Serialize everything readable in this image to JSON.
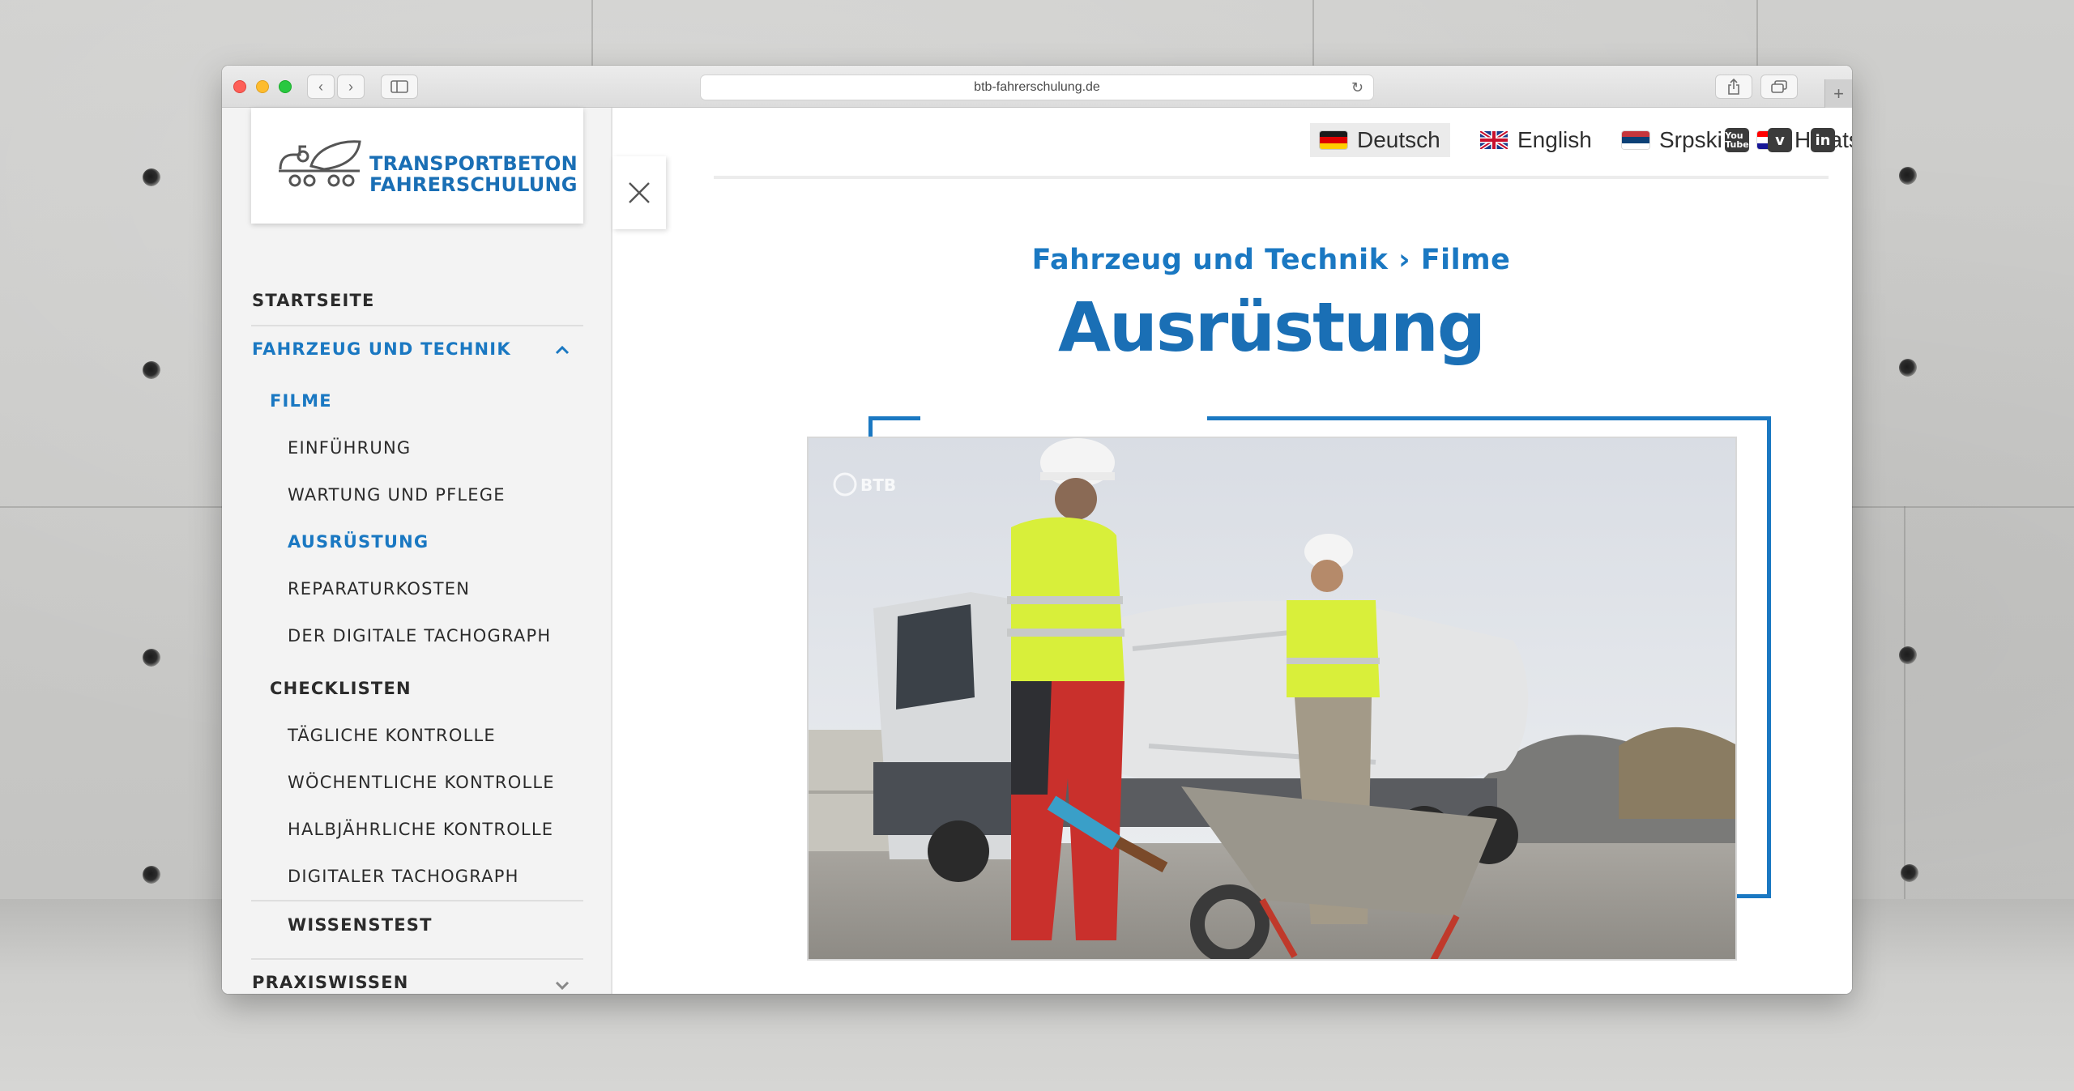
{
  "browser": {
    "url": "btb-fahrerschulung.de",
    "back_icon": "chevron-left-icon",
    "forward_icon": "chevron-right-icon"
  },
  "logo": {
    "line1": "TRANSPORTBETON",
    "line2": "FAHRERSCHULUNG"
  },
  "nav": {
    "startseite": "STARTSEITE",
    "fahrzeug": "FAHRZEUG UND TECHNIK",
    "filme": "FILME",
    "filme_items": [
      "EINFÜHRUNG",
      "WARTUNG UND PFLEGE",
      "AUSRÜSTUNG",
      "REPARATURKOSTEN",
      "DER DIGITALE TACHOGRAPH"
    ],
    "checklisten": "CHECKLISTEN",
    "checklisten_items": [
      "TÄGLICHE KONTROLLE",
      "WÖCHENTLICHE KONTROLLE",
      "HALBJÄHRLICHE KONTROLLE",
      "DIGITALER TACHOGRAPH"
    ],
    "wissenstest": "WISSENSTEST",
    "praxiswissen": "PRAXISWISSEN"
  },
  "languages": [
    {
      "label": "Deutsch",
      "active": true
    },
    {
      "label": "English",
      "active": false
    },
    {
      "label": "Srpski",
      "active": false
    },
    {
      "label": "Hrvatski",
      "active": false
    }
  ],
  "social": [
    "youtube-icon",
    "vimeo-icon",
    "linkedin-icon"
  ],
  "content": {
    "breadcrumb": "Fahrzeug und Technik › Filme",
    "title": "Ausrüstung",
    "video_watermark": "BTB"
  },
  "colors": {
    "accent": "#1a78c2"
  }
}
